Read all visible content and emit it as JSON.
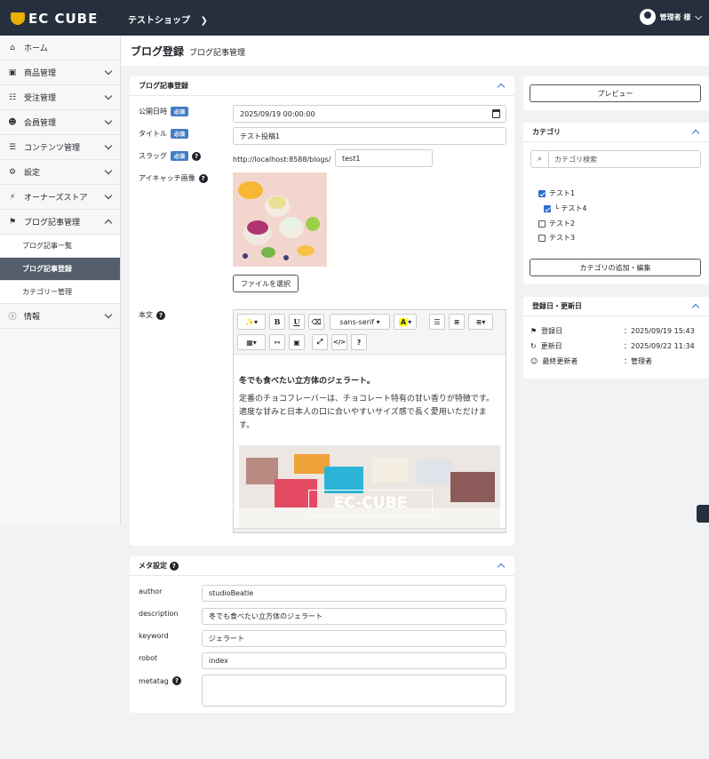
{
  "header": {
    "brand": "EC CUBE",
    "shop_name": "テストショップ",
    "user_name": "管理者 様"
  },
  "sidebar": {
    "items": [
      {
        "label": "ホーム",
        "icon": "home-icon",
        "chev": ""
      },
      {
        "label": "商品管理",
        "icon": "box-icon",
        "chev": "down"
      },
      {
        "label": "受注管理",
        "icon": "cart-icon",
        "chev": "down"
      },
      {
        "label": "会員管理",
        "icon": "users-icon",
        "chev": "down"
      },
      {
        "label": "コンテンツ管理",
        "icon": "file-icon",
        "chev": "down"
      },
      {
        "label": "設定",
        "icon": "gear-icon",
        "chev": "down"
      },
      {
        "label": "オーナーズストア",
        "icon": "plug-icon",
        "chev": "down"
      },
      {
        "label": "ブログ記事管理",
        "icon": "tag-icon",
        "chev": "up"
      }
    ],
    "subitems": [
      {
        "label": "ブログ記事一覧",
        "active": false
      },
      {
        "label": "ブログ記事登録",
        "active": true
      },
      {
        "label": "カテゴリー管理",
        "active": false
      }
    ],
    "info": {
      "label": "情報",
      "icon": "info-icon"
    }
  },
  "page": {
    "title": "ブログ登録",
    "subtitle": "ブログ記事管理"
  },
  "main_card": {
    "title": "ブログ記事登録",
    "published_label": "公開日時",
    "published_value": "2025/09/19 00:00:00",
    "title_label": "タイトル",
    "title_value": "テスト投稿1",
    "slug_label": "スラッグ",
    "slug_prefix": "http://localhost:8588/blogs/",
    "slug_value": "test1",
    "eyecatch_label": "アイキャッチ画像",
    "file_button": "ファイルを選択",
    "body_label": "本文",
    "required": "必須"
  },
  "editor": {
    "toolbar": {
      "font": "sans-serif",
      "bold": "B",
      "underline": "U",
      "help": "?",
      "code": "</>"
    },
    "heading": "冬でも食べたい立方体のジェラート。",
    "paragraph": "定番のチョコフレーバーは、チョコレート特有の甘い香りが特徴です。適度な甘みと日本人の口に合いやすいサイズ感で長く愛用いただけます。",
    "image_text": "EC-CUBE"
  },
  "meta_card": {
    "title": "メタ設定",
    "fields": [
      {
        "label": "author",
        "value": "studioBeatle"
      },
      {
        "label": "description",
        "value": "冬でも食べたい立方体のジェラート"
      },
      {
        "label": "keyword",
        "value": "ジェラート"
      },
      {
        "label": "robot",
        "value": "index"
      },
      {
        "label": "metatag",
        "value": ""
      }
    ]
  },
  "preview": {
    "label": "プレビュー"
  },
  "category": {
    "title": "カテゴリ",
    "search_placeholder": "カテゴリ検索",
    "items": [
      {
        "label": "テスト1",
        "checked": true,
        "child": false
      },
      {
        "label": "テスト4",
        "checked": true,
        "child": true
      },
      {
        "label": "テスト2",
        "checked": false,
        "child": false
      },
      {
        "label": "テスト3",
        "checked": false,
        "child": false
      }
    ],
    "add_button": "カテゴリの追加・編集"
  },
  "dates": {
    "title": "登録日・更新日",
    "rows": [
      {
        "label": "登録日",
        "value": "：2025/09/19 15:43",
        "icon": "flag-icon"
      },
      {
        "label": "更新日",
        "value": "：2025/09/22 11:34",
        "icon": "refresh-icon"
      },
      {
        "label": "最終更新者",
        "value": "：管理者",
        "icon": "user-icon"
      }
    ]
  },
  "colors": {
    "header": "#252f3d",
    "accent": "#437ec4",
    "active_nav": "#555e6b"
  }
}
